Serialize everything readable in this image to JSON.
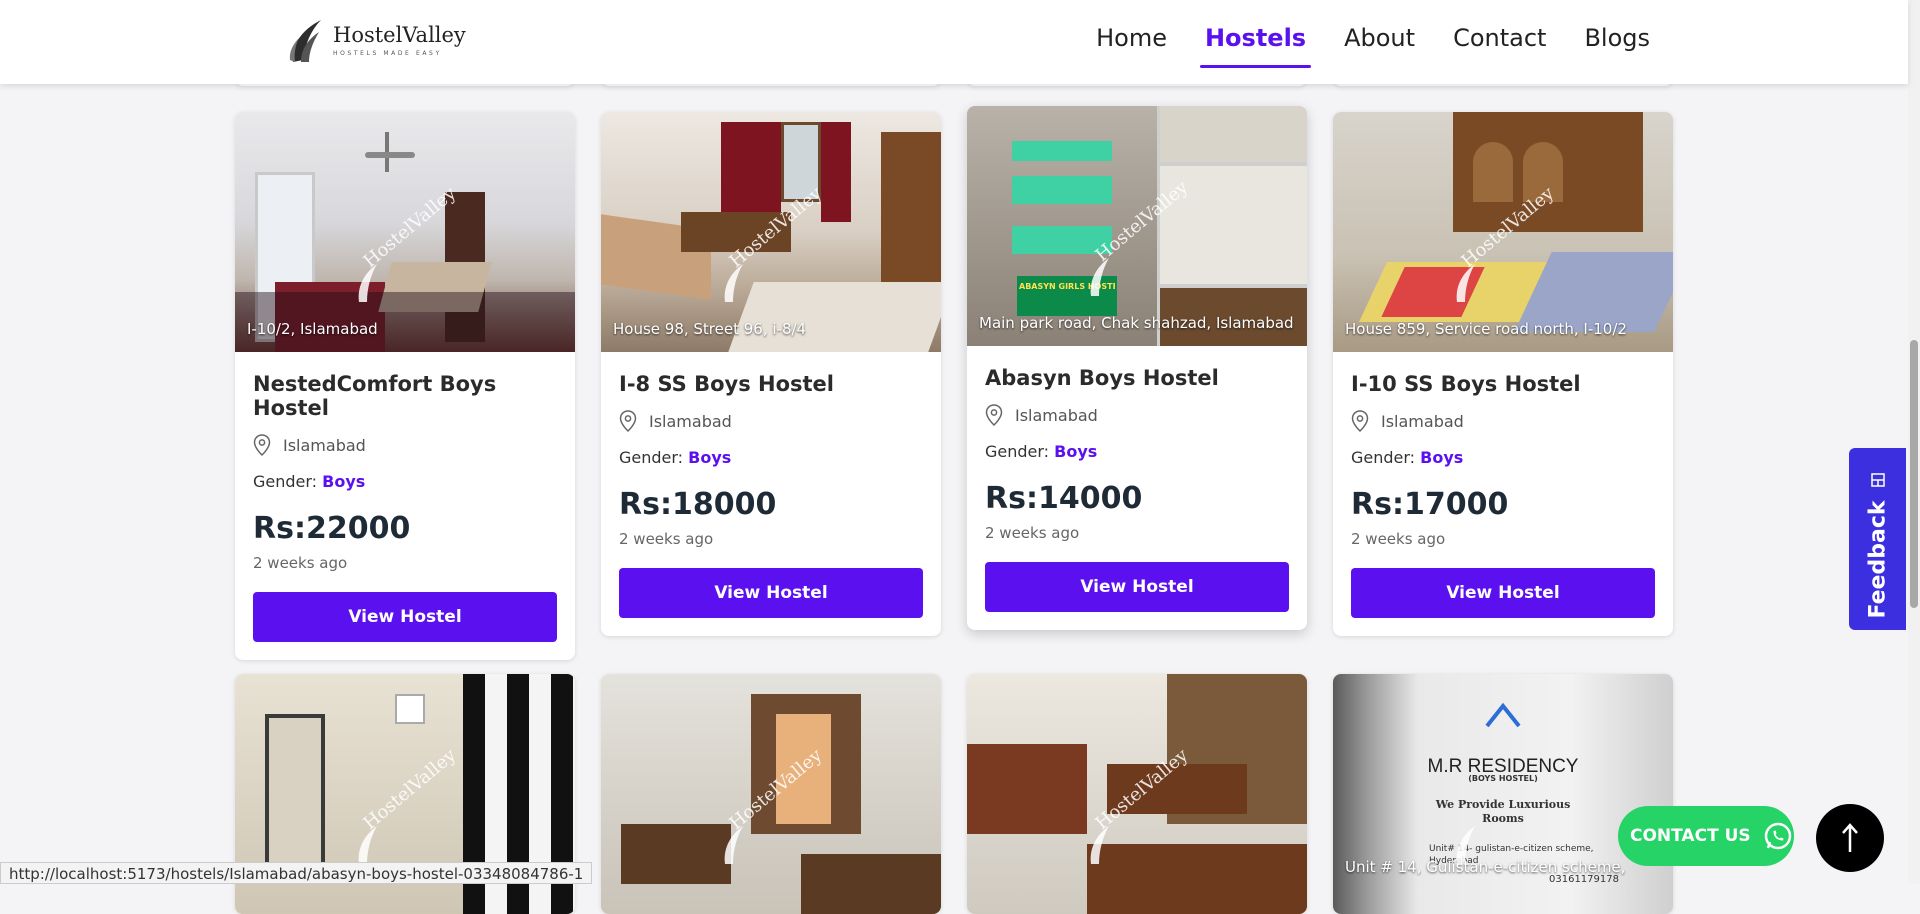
{
  "brand": {
    "name": "HostelValley",
    "tagline": "HOSTELS MADE EASY"
  },
  "nav": {
    "items": [
      "Home",
      "Hostels",
      "About",
      "Contact",
      "Blogs"
    ],
    "active": "Hostels"
  },
  "cards": [
    {
      "title": "NestedComfort Boys Hostel",
      "address": "I-10/2, Islamabad",
      "city": "Islamabad",
      "gender_label": "Gender:",
      "gender": "Boys",
      "price": "Rs:22000",
      "time": "2 weeks ago",
      "button": "View Hostel",
      "watermark": "HostelValley"
    },
    {
      "title": "I-8 SS Boys Hostel",
      "address": "House 98, Street 96, i-8/4",
      "city": "Islamabad",
      "gender_label": "Gender:",
      "gender": "Boys",
      "price": "Rs:18000",
      "time": "2 weeks ago",
      "button": "View Hostel",
      "watermark": "HostelValley"
    },
    {
      "title": "Abasyn Boys Hostel",
      "address": "Main park road, Chak shahzad, Islamabad",
      "city": "Islamabad",
      "gender_label": "Gender:",
      "gender": "Boys",
      "price": "Rs:14000",
      "time": "2 weeks ago",
      "button": "View Hostel",
      "watermark": "HostelValley",
      "sign": "ABASYN GIRLS HOSTEL"
    },
    {
      "title": "I-10 SS Boys Hostel",
      "address": "House 859, Service road north, I-10/2",
      "city": "Islamabad",
      "gender_label": "Gender:",
      "gender": "Boys",
      "price": "Rs:17000",
      "time": "2 weeks ago",
      "button": "View Hostel",
      "watermark": "HostelValley"
    }
  ],
  "row2": [
    {
      "watermark": "HostelValley"
    },
    {
      "watermark": "HostelValley"
    },
    {
      "watermark": "HostelValley"
    },
    {
      "address": "Unit # 14, Gulistan-e-citizen scheme,",
      "poster_title": "M.R RESIDENCY",
      "poster_sub": "(BOYS HOSTEL)",
      "poster_line": "We Provide Luxurious",
      "poster_line2": "Rooms",
      "poster_addr": "Unit# 14- gulistan-e-citizen scheme,",
      "poster_addr2": "Hyderabad",
      "poster_phone": "03161179178"
    }
  ],
  "feedback": "Feedback",
  "contact": "CONTACT US",
  "status_url": "http://localhost:5173/hostels/Islamabad/abasyn-boys-hostel-03348084786-1",
  "colors": {
    "primary": "#5b10f0",
    "whatsapp": "#25d366",
    "feedback": "#3b2fe0"
  }
}
